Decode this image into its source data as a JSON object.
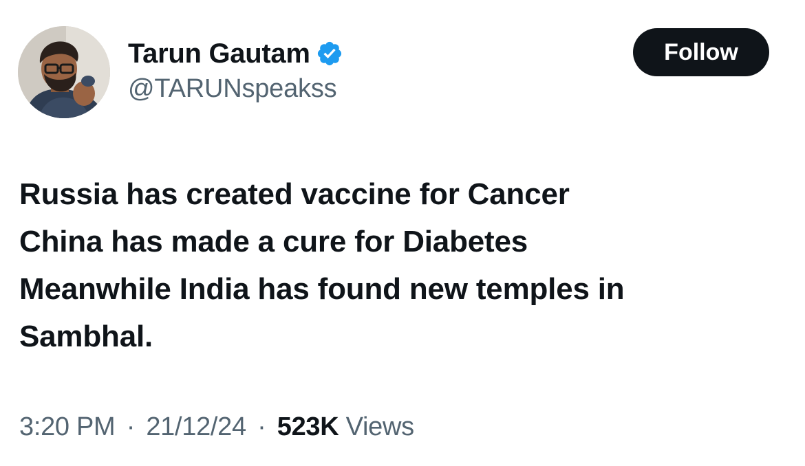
{
  "author": {
    "display_name": "Tarun Gautam",
    "handle": "@TARUNspeakss",
    "verified": true,
    "verified_badge_color": "#1d9bf0",
    "avatar_icon": "profile-photo"
  },
  "follow_button": {
    "label": "Follow",
    "color": "#0f1419"
  },
  "tweet": {
    "lines": [
      "Russia has created vaccine for Cancer",
      "China has made a cure for Diabetes",
      "Meanwhile India has found new temples in",
      "Sambhal."
    ]
  },
  "meta": {
    "time": "3:20 PM",
    "separator": "·",
    "date": "21/12/24",
    "views_count": "523K",
    "views_label": "Views"
  }
}
